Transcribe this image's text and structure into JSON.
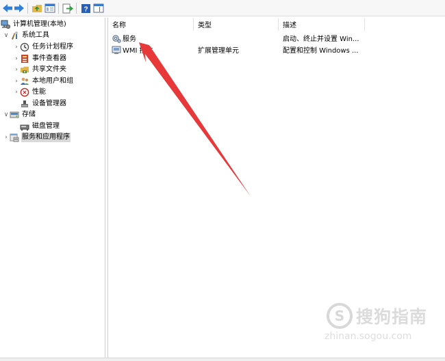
{
  "tree": {
    "root": {
      "label": "计算机管理(本地)",
      "icon": "computer-management-icon"
    },
    "items": [
      {
        "label": "系统工具",
        "icon": "system-tools-icon",
        "expander": "expanded"
      },
      {
        "label": "任务计划程序",
        "icon": "task-scheduler-icon",
        "expander": "collapsed"
      },
      {
        "label": "事件查看器",
        "icon": "event-viewer-icon",
        "expander": "collapsed"
      },
      {
        "label": "共享文件夹",
        "icon": "shared-folders-icon",
        "expander": "collapsed"
      },
      {
        "label": "本地用户和组",
        "icon": "local-users-icon",
        "expander": "collapsed"
      },
      {
        "label": "性能",
        "icon": "performance-icon",
        "expander": "collapsed"
      },
      {
        "label": "设备管理器",
        "icon": "device-manager-icon",
        "expander": "none"
      },
      {
        "label": "存储",
        "icon": "storage-icon",
        "expander": "expanded"
      },
      {
        "label": "磁盘管理",
        "icon": "disk-management-icon",
        "expander": "none"
      },
      {
        "label": "服务和应用程序",
        "icon": "services-apps-icon",
        "expander": "collapsed",
        "selected": true
      }
    ]
  },
  "list": {
    "columns": [
      "名称",
      "类型",
      "描述"
    ],
    "rows": [
      {
        "name": "服务",
        "type": "",
        "description": "启动、终止并设置 Win...",
        "icon": "services-gear-icon"
      },
      {
        "name": "WMI 控件",
        "type": "扩展管理单元",
        "description": "配置和控制 Windows ...",
        "icon": "wmi-control-icon"
      }
    ]
  },
  "annotation": {
    "color": "#e8393a"
  },
  "watermark": {
    "line1": "搜狗指南",
    "line2": "zhinan.sogou.com"
  },
  "colors": {
    "accent": "#1a73c8",
    "selection": "#d9d9d9"
  }
}
